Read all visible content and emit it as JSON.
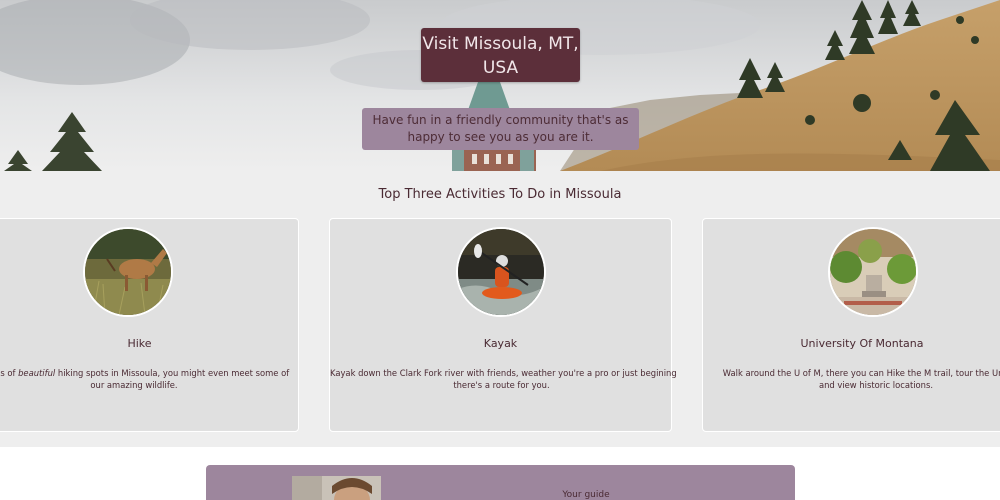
{
  "hero": {
    "title_line1": "Visit Missoula, MT,",
    "title_line2": "USA",
    "subtitle_line1": "Have fun in a friendly community that's as",
    "subtitle_line2": "happy to see you as you are it."
  },
  "activities": {
    "heading": "Top Three Activities To Do in Missoula",
    "cards": [
      {
        "title": "Hike",
        "text_line1_pre": "e tons of ",
        "text_line1_em": "beautiful",
        "text_line1_post": " hiking spots in Missoula, you might even meet some of",
        "text_line2": "our amazing wildlife.",
        "photo_icon": "deer-photo"
      },
      {
        "title": "Kayak",
        "text_line1": "Kayak down the Clark Fork river with friends, weather you're a pro or just begining",
        "text_line2": "there's a route for you.",
        "photo_icon": "kayak-photo"
      },
      {
        "title": "University Of Montana",
        "text_line1": "Walk around the U of M, there you can Hike the M trail, tour the Universit",
        "text_line2": "and view historic locations.",
        "photo_icon": "campus-photo"
      }
    ]
  },
  "guide": {
    "label": "Your guide"
  },
  "colors": {
    "title_bg": "#5c2f3a",
    "subtitle_bg": "#9d869d",
    "section_bg": "#eeeeee",
    "card_bg": "#e0e0e0",
    "text": "#4a2a33"
  }
}
